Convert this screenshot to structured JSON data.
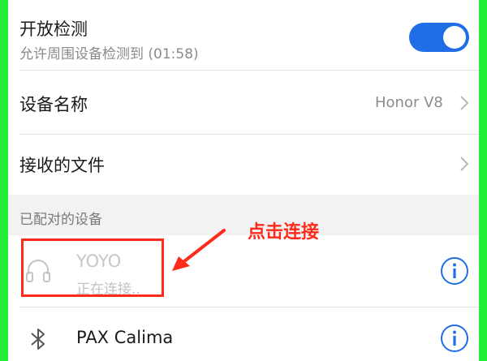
{
  "colors": {
    "accent": "#1f6ee6",
    "annotation": "#ff2a1a",
    "background_frame": "#22ee33"
  },
  "settings": {
    "open_detection": {
      "title": "开放检测",
      "subtitle": "允许周围设备检测到 (01:58)",
      "toggle_on": true
    },
    "device_name": {
      "label": "设备名称",
      "value": "Honor V8",
      "icon": "chevron-right-icon"
    },
    "received_files": {
      "label": "接收的文件",
      "icon": "chevron-right-icon"
    }
  },
  "paired_section": {
    "title": "已配对的设备",
    "annotation": "点击连接",
    "devices": [
      {
        "name": "YOYO",
        "status": "正在连接..",
        "icon": "headphones-icon",
        "info_icon": "info-icon"
      },
      {
        "name": "PAX Calima",
        "status": "",
        "icon": "bluetooth-icon",
        "info_icon": "info-icon"
      }
    ]
  }
}
